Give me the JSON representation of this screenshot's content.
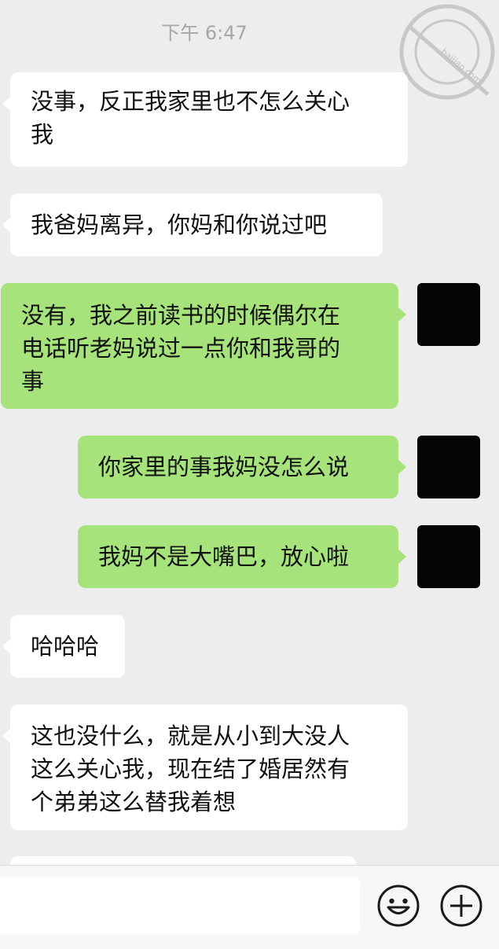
{
  "timestamp": "下午 6:47",
  "watermark": {
    "text": "海角社区",
    "url": "haijiao.com"
  },
  "messages": [
    {
      "side": "left",
      "text": "没事，反正我家里也不怎么关心\n我"
    },
    {
      "side": "left",
      "text": "我爸妈离异，你妈和你说过吧"
    },
    {
      "side": "right",
      "text": "没有，我之前读书的时候偶尔在\n电话听老妈说过一点你和我哥的\n事"
    },
    {
      "side": "right",
      "text": "你家里的事我妈没怎么说"
    },
    {
      "side": "right",
      "text": "我妈不是大嘴巴，放心啦"
    },
    {
      "side": "left",
      "text": "哈哈哈"
    },
    {
      "side": "left",
      "text": "这也没什么，就是从小到大没人\n这么关心我，现在结了婚居然有\n个弟弟这么替我着想"
    }
  ],
  "input": {
    "value": ""
  },
  "colors": {
    "background": "#ededed",
    "incoming_bubble": "#ffffff",
    "outgoing_bubble": "#a6e37a",
    "avatar": "#050505"
  },
  "icons": {
    "emoji": "emoji-icon",
    "plus": "plus-icon"
  }
}
